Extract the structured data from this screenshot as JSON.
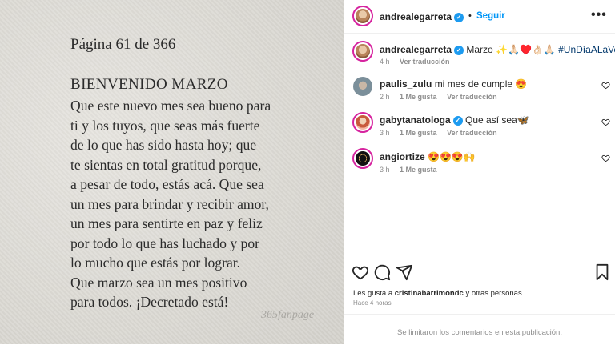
{
  "post": {
    "image_text": {
      "page": "Página 61 de 366",
      "heading": "BIENVENIDO MARZO",
      "lines": [
        "Que este nuevo mes sea bueno para",
        "ti y los tuyos, que seas más fuerte",
        "de lo que has sido hasta hoy; que",
        "te sientas en total gratitud porque,",
        "a pesar de todo, estás acá. Que sea",
        "un mes para brindar y recibir amor,",
        "un mes para sentirte en paz y feliz",
        "por todo lo que has luchado y por",
        "lo mucho que estás por lograr.",
        "Que marzo sea un mes positivo",
        "para todos. ¡Decretado está!"
      ],
      "watermark": "365fanpage"
    }
  },
  "header": {
    "username": "andrealegarreta",
    "separator": "•",
    "follow_label": "Seguir",
    "more_label": "•••"
  },
  "caption": {
    "username": "andrealegarreta",
    "text": "Marzo ✨🙏🏻♥️👌🏻🙏🏻",
    "hashtag": "#UnDíaALaVez",
    "time": "4 h",
    "translate": "Ver traducción"
  },
  "comments": [
    {
      "username": "paulis_zulu",
      "verified": false,
      "text": "mi mes de cumple 😍",
      "time": "2 h",
      "likes": "1 Me gusta",
      "translate": "Ver traducción",
      "avatar_color": "#7b8f9a"
    },
    {
      "username": "gabytanatologa",
      "verified": true,
      "text": "Que así sea🦋",
      "time": "3 h",
      "likes": "1 Me gusta",
      "translate": "Ver traducción",
      "avatar_color": "#c85a3c"
    },
    {
      "username": "angiortize",
      "verified": false,
      "text": "😍😍😍🙌",
      "time": "3 h",
      "likes": "1 Me gusta",
      "translate": "",
      "avatar_color": "#111111"
    }
  ],
  "likes": {
    "prefix": "Les gusta a",
    "user": "cristinabarrimondc",
    "suffix": "y otras personas",
    "ago": "Hace 4 horas"
  },
  "footer": {
    "limited_comments": "Se limitaron los comentarios en esta publicación."
  },
  "colors": {
    "accent": "#0095f6",
    "verified": "#1d9bf0",
    "hashtag": "#00376b",
    "muted": "#8e8e8e"
  },
  "icons": [
    "verified-icon",
    "heart-icon",
    "comment-icon",
    "share-icon",
    "bookmark-icon",
    "more-icon"
  ]
}
